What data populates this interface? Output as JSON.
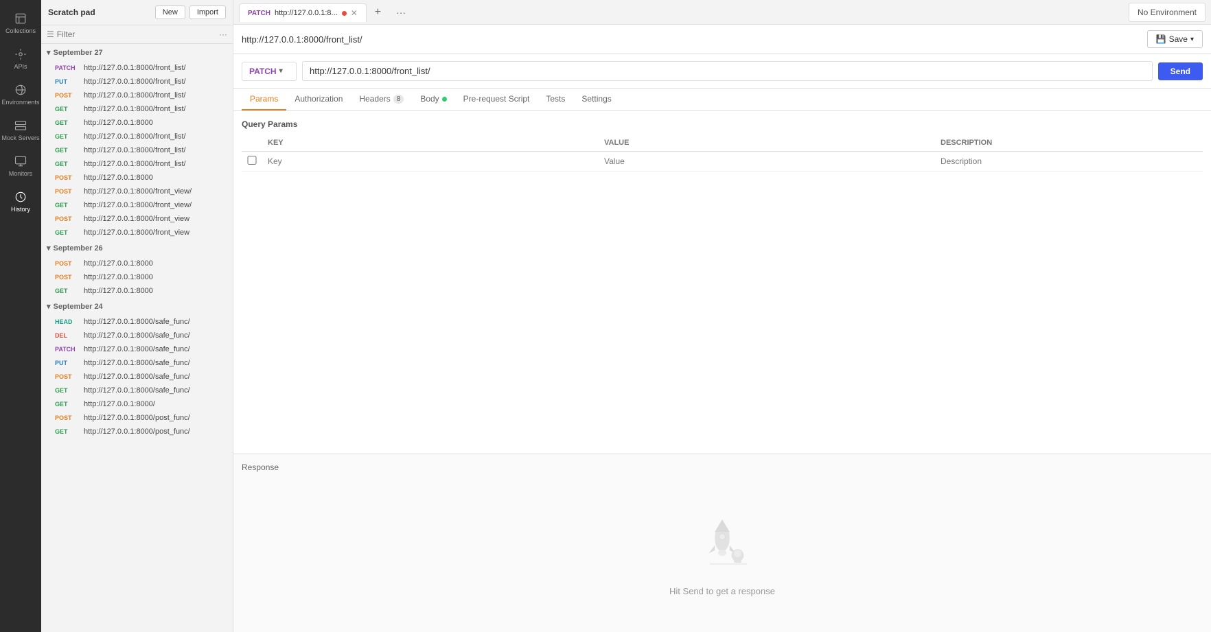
{
  "app": {
    "title": "Scratch pad",
    "no_environment": "No Environment"
  },
  "sidebar": {
    "icons": [
      {
        "id": "collections",
        "label": "Collections",
        "icon": "collections"
      },
      {
        "id": "apis",
        "label": "APIs",
        "icon": "api"
      },
      {
        "id": "environments",
        "label": "Environments",
        "icon": "environments"
      },
      {
        "id": "mock-servers",
        "label": "Mock Servers",
        "icon": "mock"
      },
      {
        "id": "monitors",
        "label": "Monitors",
        "icon": "monitor"
      },
      {
        "id": "history",
        "label": "History",
        "icon": "history",
        "active": true
      }
    ]
  },
  "header": {
    "new_label": "New",
    "import_label": "Import",
    "filter_placeholder": "Filter"
  },
  "history": {
    "groups": [
      {
        "date": "September 27",
        "collapsed": false,
        "items": [
          {
            "method": "PATCH",
            "url": "http://127.0.0.1:8000/front_list/"
          },
          {
            "method": "PUT",
            "url": "http://127.0.0.1:8000/front_list/"
          },
          {
            "method": "POST",
            "url": "http://127.0.0.1:8000/front_list/"
          },
          {
            "method": "GET",
            "url": "http://127.0.0.1:8000/front_list/"
          },
          {
            "method": "GET",
            "url": "http://127.0.0.1:8000"
          },
          {
            "method": "GET",
            "url": "http://127.0.0.1:8000/front_list/"
          },
          {
            "method": "GET",
            "url": "http://127.0.0.1:8000/front_list/"
          },
          {
            "method": "GET",
            "url": "http://127.0.0.1:8000/front_list/"
          },
          {
            "method": "POST",
            "url": "http://127.0.0.1:8000"
          },
          {
            "method": "POST",
            "url": "http://127.0.0.1:8000/front_view/"
          },
          {
            "method": "GET",
            "url": "http://127.0.0.1:8000/front_view/"
          },
          {
            "method": "POST",
            "url": "http://127.0.0.1:8000/front_view"
          },
          {
            "method": "GET",
            "url": "http://127.0.0.1:8000/front_view"
          }
        ]
      },
      {
        "date": "September 26",
        "collapsed": false,
        "items": [
          {
            "method": "POST",
            "url": "http://127.0.0.1:8000"
          },
          {
            "method": "POST",
            "url": "http://127.0.0.1:8000"
          },
          {
            "method": "GET",
            "url": "http://127.0.0.1:8000"
          }
        ]
      },
      {
        "date": "September 24",
        "collapsed": false,
        "items": [
          {
            "method": "HEAD",
            "url": "http://127.0.0.1:8000/safe_func/"
          },
          {
            "method": "DEL",
            "url": "http://127.0.0.1:8000/safe_func/"
          },
          {
            "method": "PATCH",
            "url": "http://127.0.0.1:8000/safe_func/"
          },
          {
            "method": "PUT",
            "url": "http://127.0.0.1:8000/safe_func/"
          },
          {
            "method": "POST",
            "url": "http://127.0.0.1:8000/safe_func/"
          },
          {
            "method": "GET",
            "url": "http://127.0.0.1:8000/safe_func/"
          },
          {
            "method": "GET",
            "url": "http://127.0.0.1:8000/"
          },
          {
            "method": "POST",
            "url": "http://127.0.0.1:8000/post_func/"
          },
          {
            "method": "GET",
            "url": "http://127.0.0.1:8000/post_func/"
          }
        ]
      }
    ]
  },
  "tab": {
    "method": "PATCH",
    "url_short": "http://127.0.0.1:8...",
    "has_dot": true
  },
  "request": {
    "method": "PATCH",
    "url": "http://127.0.0.1:8000/front_list/",
    "url_bar": "http://127.0.0.1:8000/front_list/",
    "save_label": "Save"
  },
  "request_tabs": [
    {
      "id": "params",
      "label": "Params",
      "active": true
    },
    {
      "id": "authorization",
      "label": "Authorization",
      "active": false
    },
    {
      "id": "headers",
      "label": "Headers",
      "badge": "8",
      "active": false
    },
    {
      "id": "body",
      "label": "Body",
      "dot": true,
      "active": false
    },
    {
      "id": "pre-request-script",
      "label": "Pre-request Script",
      "active": false
    },
    {
      "id": "tests",
      "label": "Tests",
      "active": false
    },
    {
      "id": "settings",
      "label": "Settings",
      "active": false
    }
  ],
  "params": {
    "section_title": "Query Params",
    "columns": [
      "KEY",
      "VALUE",
      "DESCRIPTION"
    ],
    "rows": [],
    "placeholder_key": "Key",
    "placeholder_value": "Value",
    "placeholder_description": "Description"
  },
  "response": {
    "label": "Response",
    "hint": "Hit Send to get a response"
  }
}
